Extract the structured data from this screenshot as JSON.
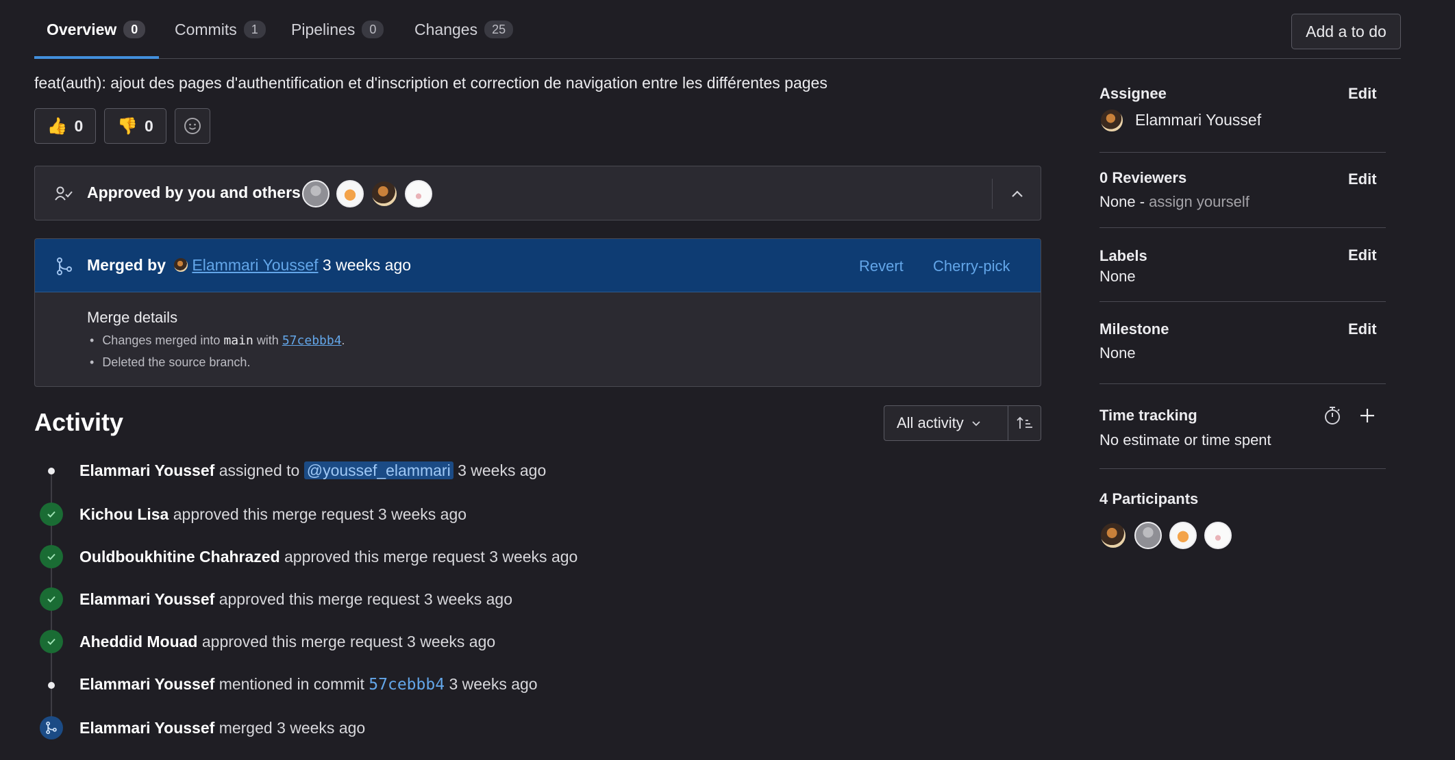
{
  "tabs": [
    {
      "label": "Overview",
      "count": "0"
    },
    {
      "label": "Commits",
      "count": "1"
    },
    {
      "label": "Pipelines",
      "count": "0"
    },
    {
      "label": "Changes",
      "count": "25"
    }
  ],
  "todo_label": "Add a to do",
  "mr_title": "feat(auth): ajout des pages d'authentification et d'inscription et correction de navigation entre les différentes pages",
  "reactions": {
    "thumbs_up": "0",
    "thumbs_down": "0"
  },
  "approval": {
    "text": "Approved by you and others"
  },
  "merge": {
    "prefix": "Merged by",
    "user": "Elammari Youssef",
    "time": "3 weeks ago",
    "revert": "Revert",
    "cherry_pick": "Cherry-pick",
    "details_title": "Merge details",
    "detail1_pre": "Changes merged into",
    "detail1_branch": "main",
    "detail1_mid": "with",
    "detail1_commit": "57cebbb4",
    "detail1_post": ".",
    "detail2": "Deleted the source branch."
  },
  "activity": {
    "heading": "Activity",
    "filter": "All activity",
    "items": [
      {
        "user": "Elammari Youssef",
        "action": "assigned to",
        "mention": "@youssef_elammari",
        "time": "3 weeks ago"
      },
      {
        "user": "Kichou Lisa",
        "action": "approved this merge request",
        "time": "3 weeks ago"
      },
      {
        "user": "Ouldboukhitine Chahrazed",
        "action": "approved this merge request",
        "time": "3 weeks ago"
      },
      {
        "user": "Elammari Youssef",
        "action": "approved this merge request",
        "time": "3 weeks ago"
      },
      {
        "user": "Aheddid Mouad",
        "action": "approved this merge request",
        "time": "3 weeks ago"
      },
      {
        "user": "Elammari Youssef",
        "action": "mentioned in commit",
        "commit": "57cebbb4",
        "time": "3 weeks ago"
      },
      {
        "user": "Elammari Youssef",
        "action": "merged",
        "time": "3 weeks ago"
      }
    ]
  },
  "sidebar": {
    "assignee_label": "Assignee",
    "assignee_name": "Elammari Youssef",
    "reviewers_label": "0 Reviewers",
    "reviewers_none": "None -",
    "reviewers_assign": "assign yourself",
    "labels_label": "Labels",
    "labels_value": "None",
    "milestone_label": "Milestone",
    "milestone_value": "None",
    "time_label": "Time tracking",
    "time_value": "No estimate or time spent",
    "participants_label": "4 Participants",
    "edit": "Edit"
  },
  "colors": {
    "accent": "#428fdc",
    "merged_bg": "#0e3c73",
    "approved": "#1a6c34",
    "link": "#63a6e9"
  },
  "icons": [
    "thumbs-up-icon",
    "thumbs-down-icon",
    "smiley-icon",
    "approval-icon",
    "chevron-up-icon",
    "merge-icon",
    "chevron-down-icon",
    "sort-icon",
    "check-icon",
    "stopwatch-icon",
    "plus-icon"
  ]
}
